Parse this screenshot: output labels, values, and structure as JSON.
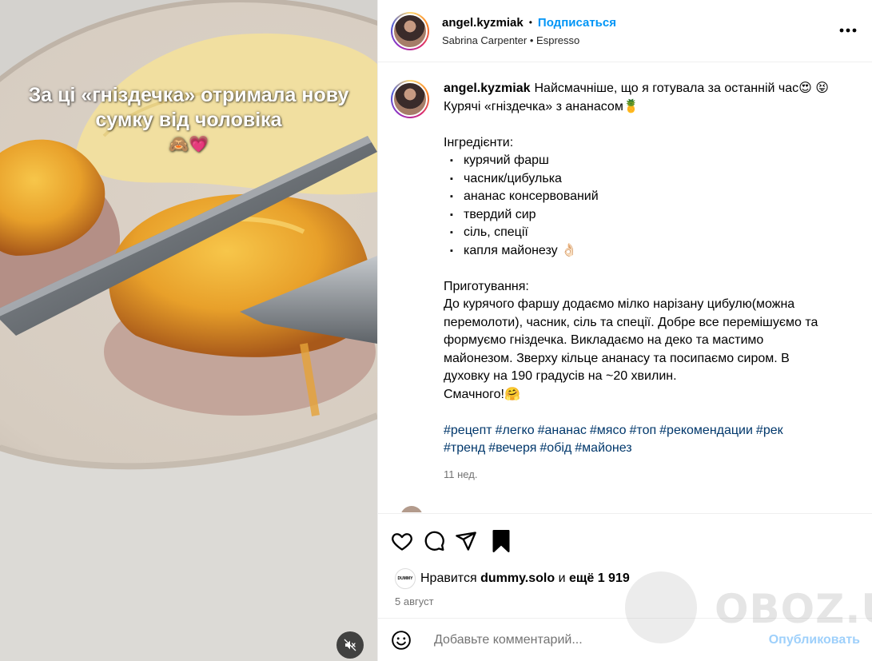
{
  "media": {
    "caption_text": "За ці «гніздечка» отримала нову сумку від чоловіка",
    "caption_emojis": "🙈💗",
    "mute_icon": "speaker-muted-icon"
  },
  "header": {
    "username": "angel.kyzmiak",
    "separator": "•",
    "follow_label": "Подписаться",
    "audio_artist": "Sabrina Carpenter",
    "audio_separator": "•",
    "audio_title": "Espresso"
  },
  "post": {
    "username": "angel.kyzmiak",
    "line1": "Найсмачніше, що я готувала за останній час😍 😝",
    "line2": "Курячі «гніздечка» з ананасом🍍",
    "ingredients_heading": "Інгредієнти:",
    "ingredients": [
      "курячий фарш",
      "часник/цибулька",
      "ананас консервований",
      "твердий сир",
      "сіль, спеції",
      "капля майонезу 👌🏻"
    ],
    "method_heading": "Приготування:",
    "method_lines": [
      "До курячого фаршу додаємо мілко нарізану цибулю(можна",
      "перемолоти), часник, сіль та спеції. Добре все перемішуємо та",
      "формуємо гніздечка. Викладаємо на деко та мастимо",
      "майонезом. Зверху кільце ананасу та посипаємо сиром. В",
      "духовку на 190 градусів на ~20 хвилин.",
      "Смачного!🤗"
    ],
    "hashtags_line1": [
      "#рецепт",
      "#легко",
      "#ананас",
      "#мясо",
      "#топ",
      "#рекомендации",
      "#рек"
    ],
    "hashtags_line2": [
      "#тренд",
      "#вечеря",
      "#обід",
      "#майонез"
    ],
    "time_ago": "11 нед."
  },
  "actions": {
    "likes_prefix": "Нравится",
    "likes_user": "dummy.solo",
    "likes_and": "и",
    "likes_more": "ещё 1 919",
    "liker_avatar_text": "DUMMY",
    "date": "5 август"
  },
  "comment_box": {
    "placeholder": "Добавьте комментарий...",
    "publish_label": "Опубликовать"
  },
  "watermark": {
    "text": "OBOZ.UA"
  },
  "colors": {
    "accent": "#0095f6",
    "link": "#00376b",
    "muted": "#737373",
    "publish_disabled": "#9ed0fb"
  }
}
